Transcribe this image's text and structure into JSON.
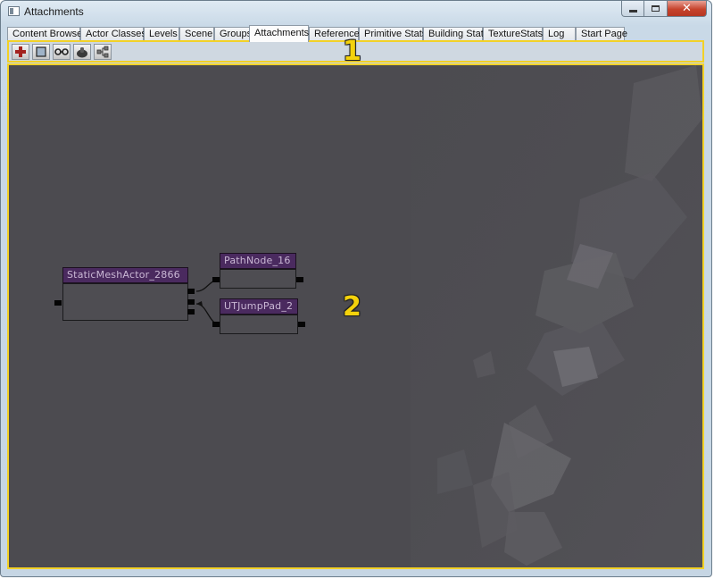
{
  "window": {
    "title": "Attachments"
  },
  "tabs": [
    {
      "label": "Content Browser"
    },
    {
      "label": "Actor Classes"
    },
    {
      "label": "Levels"
    },
    {
      "label": "Scene"
    },
    {
      "label": "Groups"
    },
    {
      "label": "Attachments"
    },
    {
      "label": "References"
    },
    {
      "label": "Primitive Stats"
    },
    {
      "label": "Building Stats"
    },
    {
      "label": "TextureStats"
    },
    {
      "label": "Log"
    },
    {
      "label": "Start Page"
    }
  ],
  "active_tab": "Attachments",
  "toolbar": {
    "buttons": [
      {
        "icon": "add-red-cross-icon"
      },
      {
        "icon": "square-select-icon"
      },
      {
        "icon": "link-chain-icon"
      },
      {
        "icon": "hand-pan-icon"
      },
      {
        "icon": "tree-layout-icon"
      }
    ]
  },
  "annotations": {
    "toolbar_marker": "1",
    "canvas_marker": "2"
  },
  "nodes": {
    "static_mesh": {
      "title": "StaticMeshActor_2866"
    },
    "path_node": {
      "title": "PathNode_16"
    },
    "jump_pad": {
      "title": "UTJumpPad_2"
    }
  },
  "colors": {
    "highlight": "#f2d127",
    "canvas_bg": "#4c4b50",
    "node_title_bg": "#4a2a5f"
  }
}
